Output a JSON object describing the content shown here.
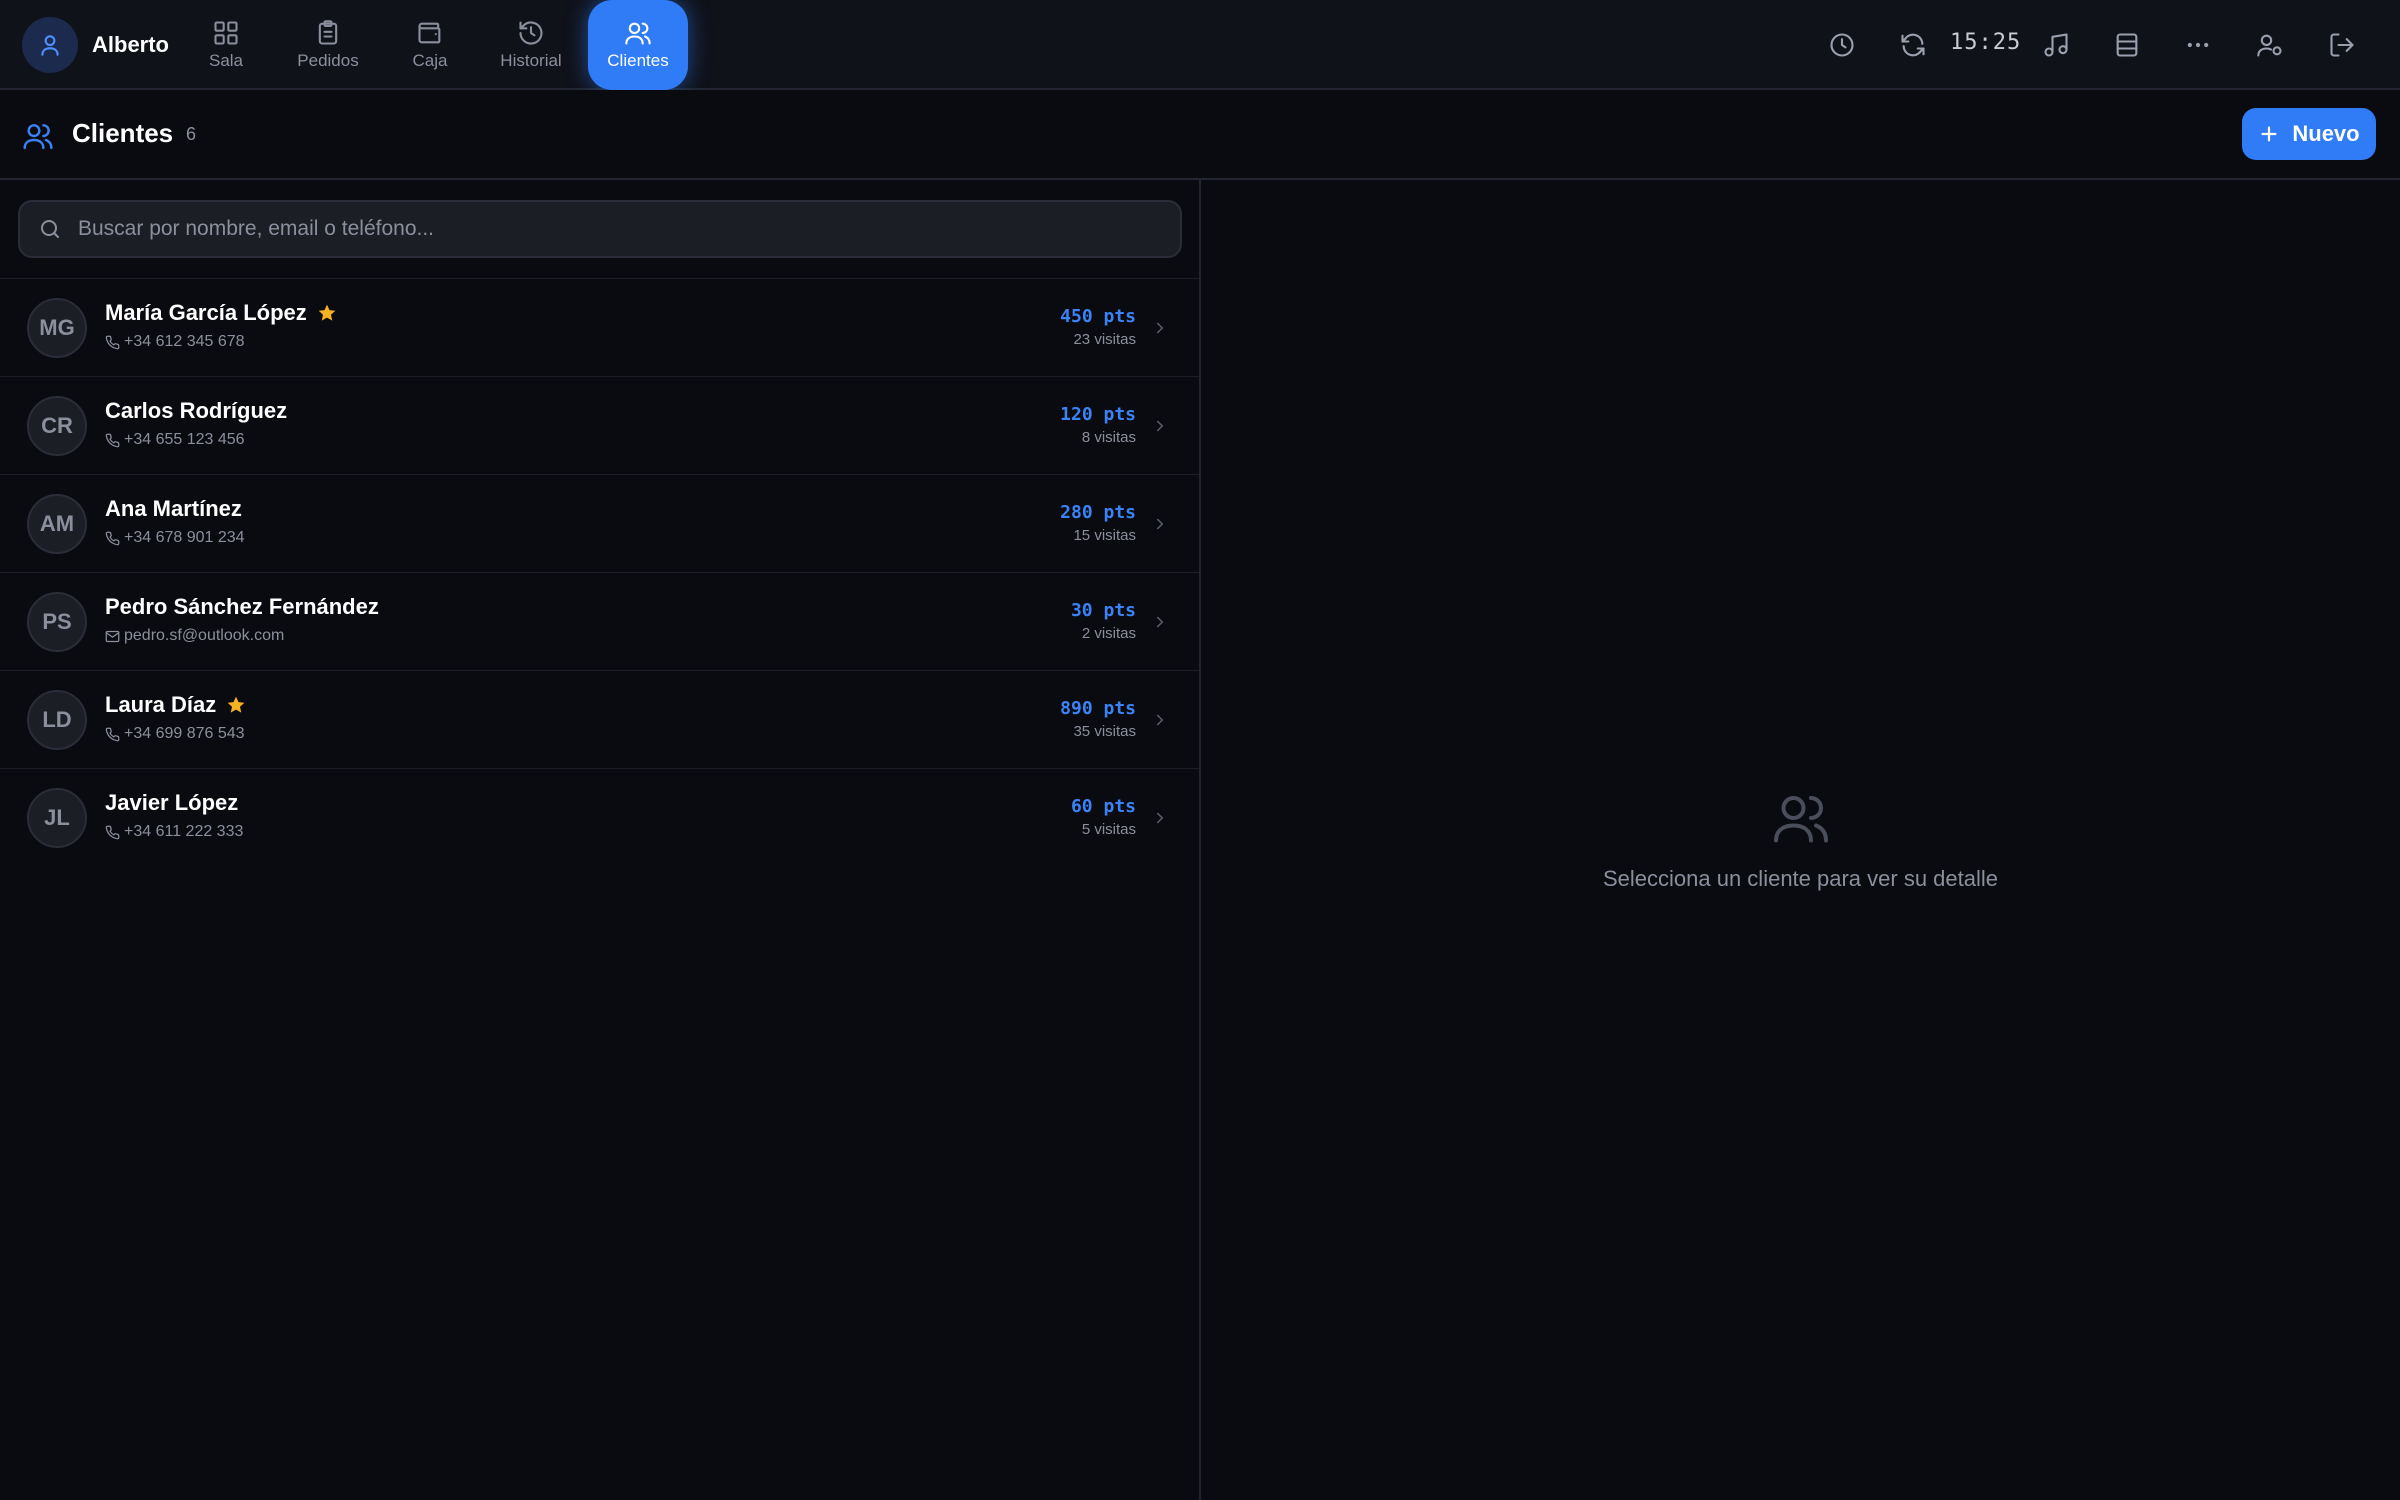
{
  "user": {
    "name": "Alberto"
  },
  "nav": {
    "tabs": [
      {
        "label": "Sala",
        "icon": "grid-icon"
      },
      {
        "label": "Pedidos",
        "icon": "clipboard-icon"
      },
      {
        "label": "Caja",
        "icon": "wallet-icon"
      },
      {
        "label": "Historial",
        "icon": "history-icon"
      },
      {
        "label": "Clientes",
        "icon": "users-icon",
        "active": true
      }
    ]
  },
  "toolbar": {
    "time": "15:25",
    "icons": [
      "clock-icon",
      "refresh-icon",
      "music-icon",
      "list-icon",
      "more-icon",
      "user-settings-icon",
      "logout-icon"
    ]
  },
  "header": {
    "title": "Clientes",
    "count": "6",
    "new_button_label": "Nuevo"
  },
  "search": {
    "placeholder": "Buscar por nombre, email o teléfono..."
  },
  "clients": [
    {
      "initials": "MG",
      "name": "María García López",
      "vip": true,
      "contact_type": "phone",
      "contact": "+34 612 345 678",
      "points": "450 pts",
      "visits": "23 visitas"
    },
    {
      "initials": "CR",
      "name": "Carlos Rodríguez",
      "vip": false,
      "contact_type": "phone",
      "contact": "+34 655 123 456",
      "points": "120 pts",
      "visits": "8 visitas"
    },
    {
      "initials": "AM",
      "name": "Ana Martínez",
      "vip": false,
      "contact_type": "phone",
      "contact": "+34 678 901 234",
      "points": "280 pts",
      "visits": "15 visitas"
    },
    {
      "initials": "PS",
      "name": "Pedro Sánchez Fernández",
      "vip": false,
      "contact_type": "email",
      "contact": "pedro.sf@outlook.com",
      "points": "30 pts",
      "visits": "2 visitas"
    },
    {
      "initials": "LD",
      "name": "Laura Díaz",
      "vip": true,
      "contact_type": "phone",
      "contact": "+34 699 876 543",
      "points": "890 pts",
      "visits": "35 visitas"
    },
    {
      "initials": "JL",
      "name": "Javier López",
      "vip": false,
      "contact_type": "phone",
      "contact": "+34 611 222 333",
      "points": "60 pts",
      "visits": "5 visitas"
    }
  ],
  "detail": {
    "empty_message": "Selecciona un cliente para ver su detalle"
  },
  "colors": {
    "accent": "#2f7cf6",
    "points": "#3b82f6",
    "star": "#f5b121",
    "background": "#0a0b10",
    "topbar": "#10121a"
  }
}
